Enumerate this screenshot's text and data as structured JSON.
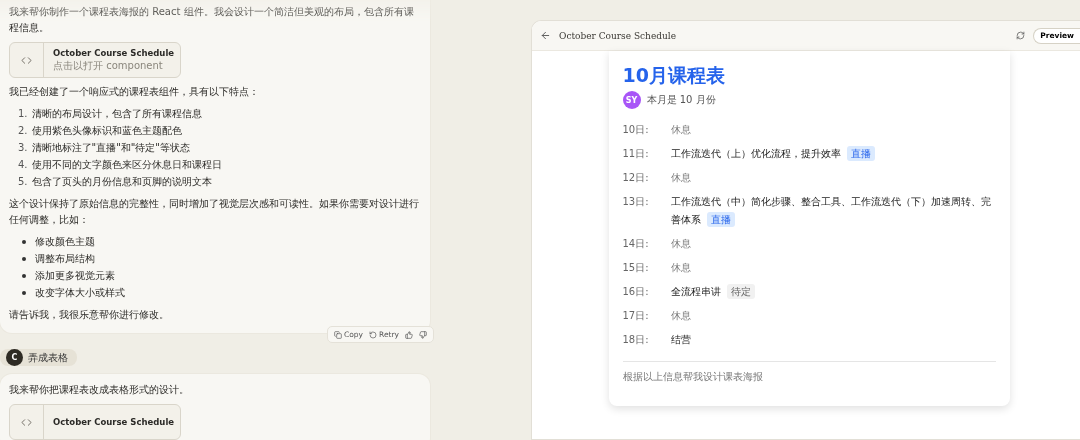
{
  "chat": {
    "messages": [
      {
        "kind": "assistant",
        "blocks": [
          {
            "kind": "text",
            "text": "我来帮你制作一个课程表海报的 React 组件。我会设计一个简洁但美观的布局，包含所有课程信息。"
          },
          {
            "kind": "artifact",
            "title": "October Course Schedule",
            "subtitle": "点击以打开 component"
          },
          {
            "kind": "text",
            "text": "我已经创建了一个响应式的课程表组件，具有以下特点："
          },
          {
            "kind": "ordered",
            "items": [
              {
                "number": "1.",
                "text": "清晰的布局设计，包含了所有课程信息"
              },
              {
                "number": "2.",
                "text": "使用紫色头像标识和蓝色主题配色"
              },
              {
                "number": "3.",
                "text": "清晰地标注了\"直播\"和\"待定\"等状态"
              },
              {
                "number": "4.",
                "text": "使用不同的文字颜色来区分休息日和课程日"
              },
              {
                "number": "5.",
                "text": "包含了页头的月份信息和页脚的说明文本"
              }
            ]
          },
          {
            "kind": "text",
            "text": "这个设计保持了原始信息的完整性，同时增加了视觉层次感和可读性。如果你需要对设计进行任何调整，比如："
          },
          {
            "kind": "bullets",
            "items": [
              "修改颜色主题",
              "调整布局结构",
              "添加更多视觉元素",
              "改变字体大小或样式"
            ]
          },
          {
            "kind": "text",
            "text": "请告诉我，我很乐意帮你进行修改。"
          }
        ],
        "actions": {
          "copy": "Copy",
          "retry": "Retry"
        }
      },
      {
        "kind": "user",
        "avatar": "C",
        "text": "弄成表格"
      },
      {
        "kind": "assistant",
        "blocks": [
          {
            "kind": "text",
            "text": "我来帮你把课程表改成表格形式的设计。"
          },
          {
            "kind": "artifact",
            "title": "October Course Schedule"
          }
        ]
      }
    ]
  },
  "panel": {
    "title": "October Course Schedule",
    "preview_button": "Preview",
    "schedule": {
      "title": "10月课程表",
      "avatar": "SY",
      "subtitle": "本月是 10 月份",
      "rows": [
        {
          "date": "10日:",
          "kind": "rest",
          "text": "休息"
        },
        {
          "date": "11日:",
          "kind": "course",
          "text": "工作流迭代（上）优化流程，提升效率",
          "tag": {
            "kind": "live",
            "label": "直播"
          }
        },
        {
          "date": "12日:",
          "kind": "rest",
          "text": "休息"
        },
        {
          "date": "13日:",
          "kind": "course",
          "text": "工作流迭代（中）简化步骤、整合工具、工作流迭代（下）加速周转、完善体系",
          "tag": {
            "kind": "live",
            "label": "直播"
          }
        },
        {
          "date": "14日:",
          "kind": "rest",
          "text": "休息"
        },
        {
          "date": "15日:",
          "kind": "rest",
          "text": "休息"
        },
        {
          "date": "16日:",
          "kind": "course",
          "text": "全流程串讲",
          "tag": {
            "kind": "pending",
            "label": "待定"
          }
        },
        {
          "date": "17日:",
          "kind": "rest",
          "text": "休息"
        },
        {
          "date": "18日:",
          "kind": "course",
          "text": "结营"
        }
      ],
      "footer": "根据以上信息帮我设计课表海报"
    }
  }
}
